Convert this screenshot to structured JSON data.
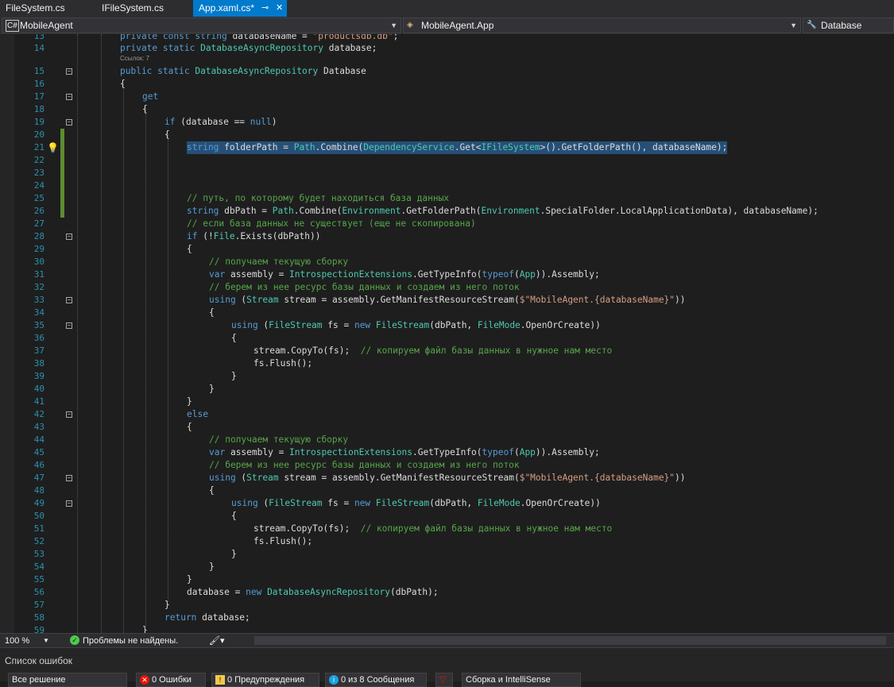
{
  "tabs": [
    {
      "label": "FileSystem.cs"
    },
    {
      "label": "IFileSystem.cs"
    },
    {
      "label": "App.xaml.cs*",
      "pin": "⊸",
      "close": "✕"
    }
  ],
  "nav": {
    "project": "MobileAgent",
    "type": "MobileAgent.App",
    "member": "Database"
  },
  "editor": {
    "refs_label": "Ссылок: 7",
    "lines": [
      {
        "n": "13",
        "code": "private const string databaseName = \"productsdb.db\";"
      },
      {
        "n": "14",
        "code": "private static DatabaseAsyncRepository database;"
      },
      {
        "n": "15",
        "code": "public static DatabaseAsyncRepository Database"
      },
      {
        "n": "16",
        "code": "{"
      },
      {
        "n": "17",
        "code": "get"
      },
      {
        "n": "18",
        "code": "{"
      },
      {
        "n": "19",
        "code": "if (database == null)"
      },
      {
        "n": "20",
        "code": "{"
      },
      {
        "n": "21",
        "code": "string folderPath = Path.Combine(DependencyService.Get<IFileSystem>().GetFolderPath(), databaseName);"
      },
      {
        "n": "22",
        "code": ""
      },
      {
        "n": "23",
        "code": ""
      },
      {
        "n": "24",
        "code": ""
      },
      {
        "n": "25",
        "code": "// путь, по которому будет находиться база данных"
      },
      {
        "n": "26",
        "code": "string dbPath = Path.Combine(Environment.GetFolderPath(Environment.SpecialFolder.LocalApplicationData), databaseName);"
      },
      {
        "n": "27",
        "code": "// если база данных не существует (еще не скопирована)"
      },
      {
        "n": "28",
        "code": "if (!File.Exists(dbPath))"
      },
      {
        "n": "29",
        "code": "{"
      },
      {
        "n": "30",
        "code": "// получаем текущую сборку"
      },
      {
        "n": "31",
        "code": "var assembly = IntrospectionExtensions.GetTypeInfo(typeof(App)).Assembly;"
      },
      {
        "n": "32",
        "code": "// берем из нее ресурс базы данных и создаем из него поток"
      },
      {
        "n": "33",
        "code": "using (Stream stream = assembly.GetManifestResourceStream($\"MobileAgent.{databaseName}\"))"
      },
      {
        "n": "34",
        "code": "{"
      },
      {
        "n": "35",
        "code": "using (FileStream fs = new FileStream(dbPath, FileMode.OpenOrCreate))"
      },
      {
        "n": "36",
        "code": "{"
      },
      {
        "n": "37",
        "code": "stream.CopyTo(fs);  // копируем файл базы данных в нужное нам место"
      },
      {
        "n": "38",
        "code": "fs.Flush();"
      },
      {
        "n": "39",
        "code": "}"
      },
      {
        "n": "40",
        "code": "}"
      },
      {
        "n": "41",
        "code": "}"
      },
      {
        "n": "42",
        "code": "else"
      },
      {
        "n": "43",
        "code": "{"
      },
      {
        "n": "44",
        "code": "// получаем текущую сборку"
      },
      {
        "n": "45",
        "code": "var assembly = IntrospectionExtensions.GetTypeInfo(typeof(App)).Assembly;"
      },
      {
        "n": "46",
        "code": "// берем из нее ресурс базы данных и создаем из него поток"
      },
      {
        "n": "47",
        "code": "using (Stream stream = assembly.GetManifestResourceStream($\"MobileAgent.{databaseName}\"))"
      },
      {
        "n": "48",
        "code": "{"
      },
      {
        "n": "49",
        "code": "using (FileStream fs = new FileStream(dbPath, FileMode.OpenOrCreate))"
      },
      {
        "n": "50",
        "code": "{"
      },
      {
        "n": "51",
        "code": "stream.CopyTo(fs);  // копируем файл базы данных в нужное нам место"
      },
      {
        "n": "52",
        "code": "fs.Flush();"
      },
      {
        "n": "53",
        "code": "}"
      },
      {
        "n": "54",
        "code": "}"
      },
      {
        "n": "55",
        "code": "}"
      },
      {
        "n": "56",
        "code": "database = new DatabaseAsyncRepository(dbPath);"
      },
      {
        "n": "57",
        "code": "}"
      },
      {
        "n": "58",
        "code": "return database;"
      },
      {
        "n": "59",
        "code": "}"
      }
    ]
  },
  "statusbar": {
    "zoom": "100 %",
    "issues": "Проблемы не найдены."
  },
  "error_list": {
    "title": "Список ошибок",
    "scope": "Все решение",
    "errors": "0 Ошибки",
    "warnings": "0 Предупреждения",
    "messages": "0 из 8 Сообщения",
    "build_filter": "Сборка и IntelliSense"
  },
  "colors": {
    "accent": "#007acc",
    "keyword": "#569cd6",
    "type": "#4ec9b0",
    "comment": "#57a64a",
    "string": "#d69d85",
    "selection": "#264f78"
  }
}
